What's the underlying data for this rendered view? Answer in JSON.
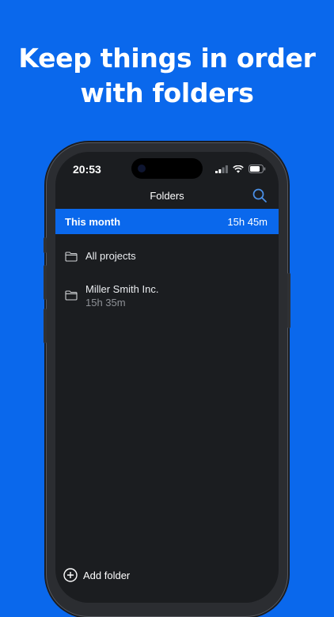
{
  "headline": {
    "line1": "Keep things in order",
    "line2": "with folders"
  },
  "status_bar": {
    "time": "20:53",
    "icons": [
      "signal-icon",
      "wifi-icon",
      "battery-icon"
    ]
  },
  "nav": {
    "title": "Folders",
    "search_icon": "search-icon"
  },
  "summary": {
    "label": "This month",
    "total": "15h 45m"
  },
  "folders": [
    {
      "name": "All projects",
      "duration": ""
    },
    {
      "name": "Miller Smith Inc.",
      "duration": "15h 35m"
    }
  ],
  "add_folder": {
    "label": "Add folder"
  },
  "colors": {
    "background": "#0a68ec",
    "screen": "#1b1d20",
    "accent": "#0a68ec",
    "search_icon": "#4a90e8"
  }
}
